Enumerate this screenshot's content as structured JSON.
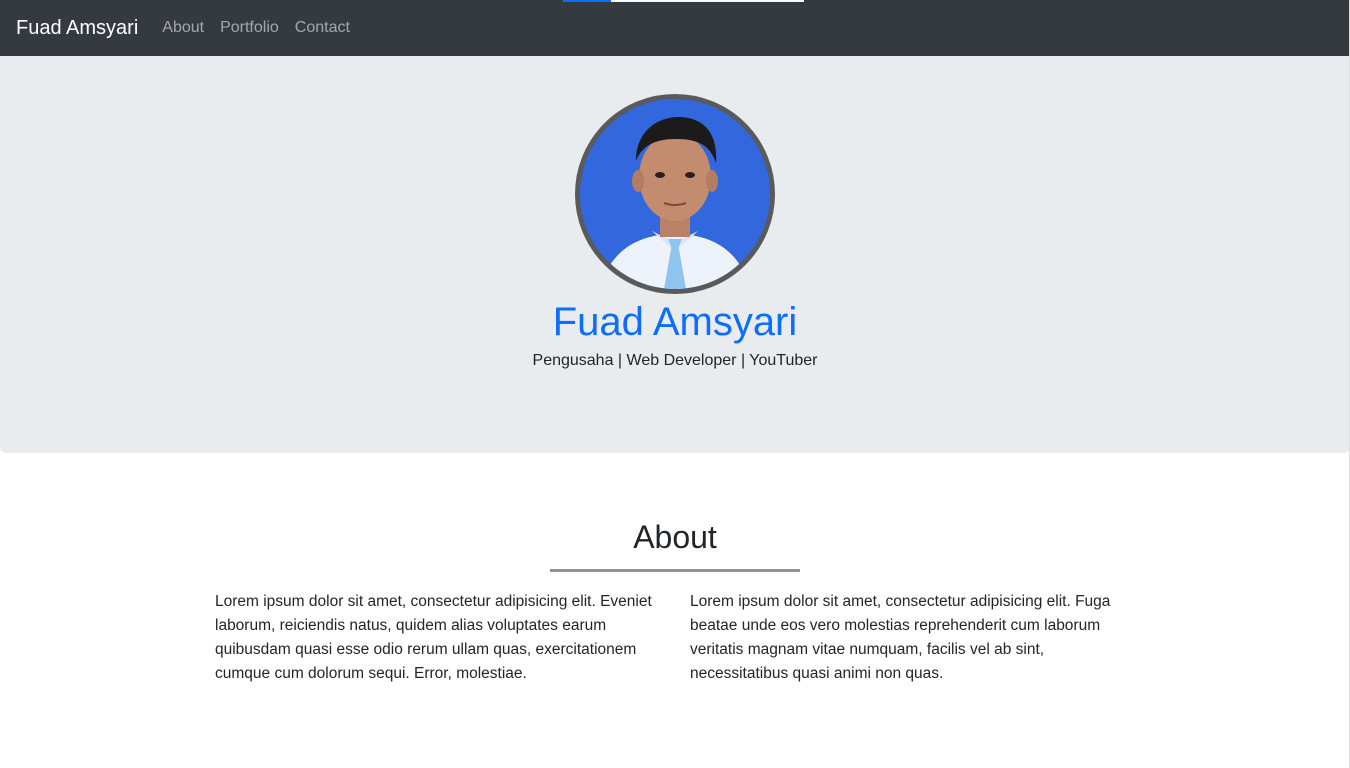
{
  "navbar": {
    "brand": "Fuad Amsyari",
    "links": [
      "About",
      "Portfolio",
      "Contact"
    ]
  },
  "hero": {
    "avatar": "profile-photo",
    "name": "Fuad Amsyari",
    "tagline": "Pengusaha | Web Developer | YouTuber"
  },
  "about": {
    "title": "About",
    "paragraphs": [
      "Lorem ipsum dolor sit amet, consectetur adipisicing elit. Eveniet laborum, reiciendis natus, quidem alias voluptates earum quibusdam quasi esse odio rerum ullam quas, exercitationem cumque cum dolorum sequi. Error, molestiae.",
      "Lorem ipsum dolor sit amet, consectetur adipisicing elit. Fuga beatae unde eos vero molestias reprehenderit cum laborum veritatis magnam vitae numquam, facilis vel ab sint, necessitatibus quasi animi non quas."
    ]
  },
  "colors": {
    "navbar_bg": "#343a40",
    "hero_bg": "#e9ecef",
    "accent": "#0d6efd"
  }
}
